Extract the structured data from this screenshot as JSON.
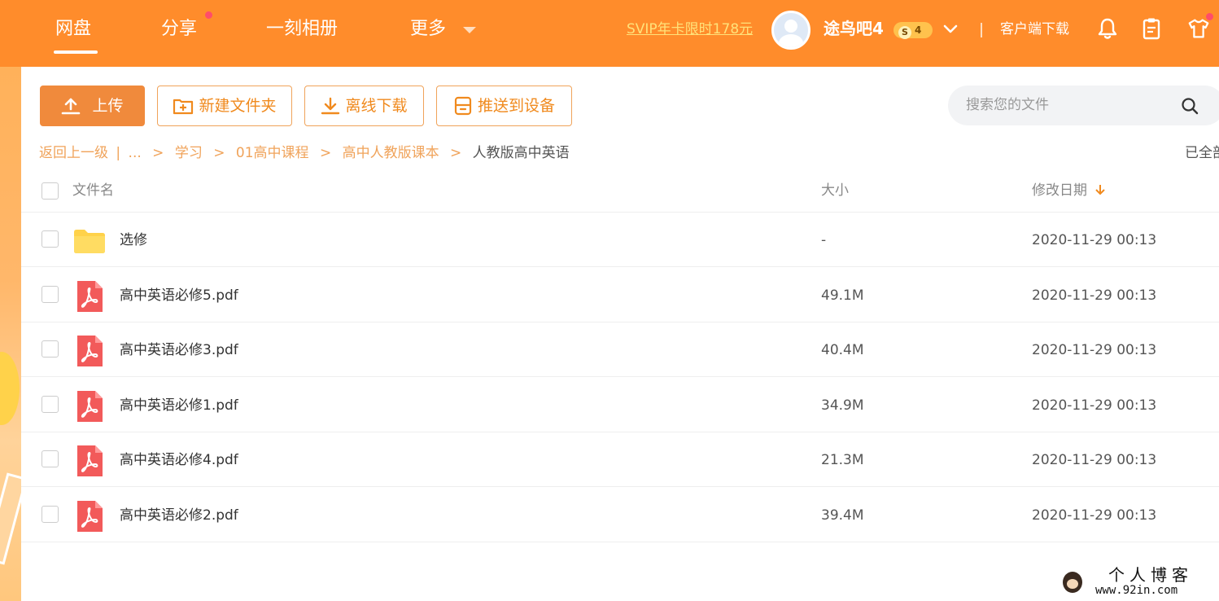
{
  "topnav": {
    "items": [
      {
        "label": "网盘",
        "active": true
      },
      {
        "label": "分享",
        "badge_dot": true
      },
      {
        "label": "一刻相册"
      },
      {
        "label": "更多",
        "has_dropdown": true
      }
    ],
    "promo_link": "SVIP年卡限时178元",
    "username": "途鸟吧4",
    "level_badge": {
      "icon": "S",
      "level": "4"
    },
    "client_download": "客户端下载",
    "icons": [
      "bell-icon",
      "clipboard-icon",
      "tshirt-icon"
    ]
  },
  "toolbar": {
    "upload_label": "上传",
    "new_folder_label": "新建文件夹",
    "offline_download_label": "离线下载",
    "push_device_label": "推送到设备"
  },
  "search": {
    "placeholder": "搜索您的文件"
  },
  "breadcrumb": {
    "back": "返回上一级",
    "separator_pipe": "|",
    "ellipsis": "...",
    "items": [
      "学习",
      "01高中课程",
      "高中人教版课本"
    ],
    "current": "人教版高中英语",
    "loaded_status": "已全部加载"
  },
  "table": {
    "headers": {
      "name": "文件名",
      "size": "大小",
      "date": "修改日期"
    },
    "sort": {
      "column": "date",
      "direction": "desc"
    },
    "rows": [
      {
        "type": "folder",
        "name": "选修",
        "size": "-",
        "date": "2020-11-29 00:13"
      },
      {
        "type": "pdf",
        "name": "高中英语必修5.pdf",
        "size": "49.1M",
        "date": "2020-11-29 00:13"
      },
      {
        "type": "pdf",
        "name": "高中英语必修3.pdf",
        "size": "40.4M",
        "date": "2020-11-29 00:13"
      },
      {
        "type": "pdf",
        "name": "高中英语必修1.pdf",
        "size": "34.9M",
        "date": "2020-11-29 00:13"
      },
      {
        "type": "pdf",
        "name": "高中英语必修4.pdf",
        "size": "21.3M",
        "date": "2020-11-29 00:13"
      },
      {
        "type": "pdf",
        "name": "高中英语必修2.pdf",
        "size": "39.4M",
        "date": "2020-11-29 00:13"
      }
    ]
  },
  "watermark": {
    "title": "个人博客",
    "url": "www.92in.com"
  },
  "colors": {
    "brand": "#ff8c2b",
    "accent": "#f08a3c",
    "link": "#f0a35a",
    "pdf_red": "#f25a5a",
    "folder_yellow": "#ffd24a"
  }
}
